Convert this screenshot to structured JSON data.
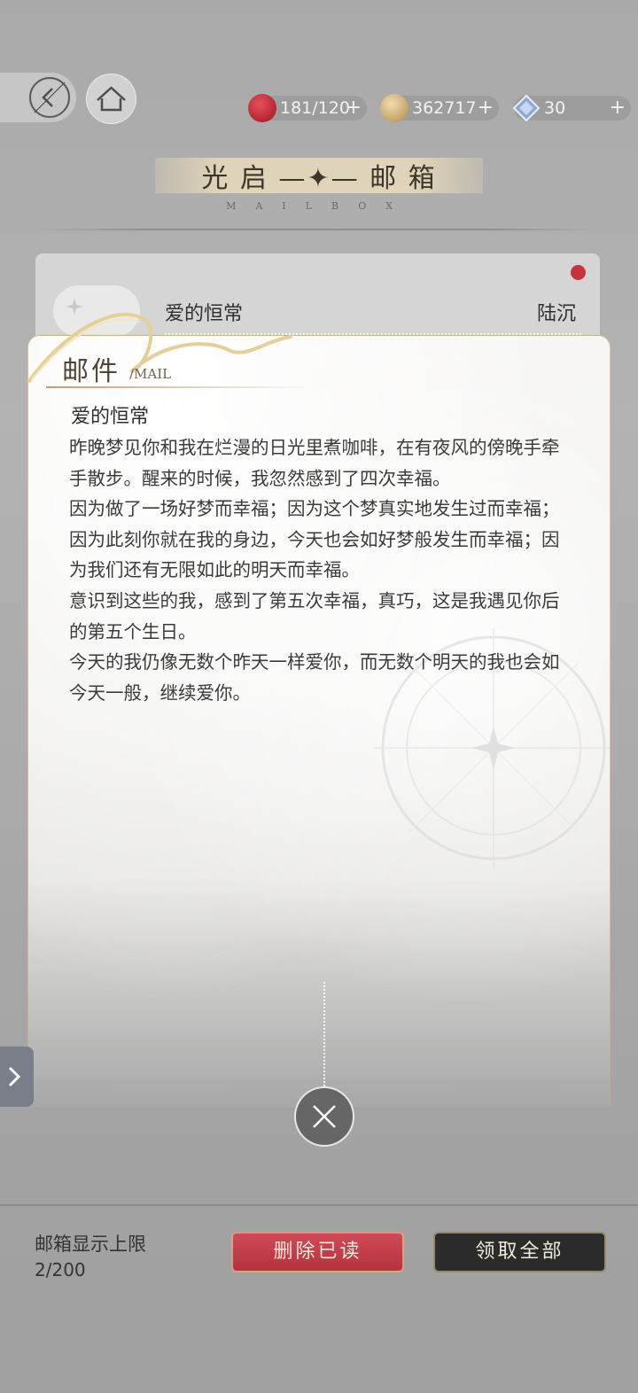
{
  "header": {
    "title": "光 启 —✦— 邮 箱",
    "subtitle": "MAILBOX"
  },
  "resources": [
    {
      "icon": "apple-icon",
      "value": "181/120",
      "plus": "+"
    },
    {
      "icon": "coin-icon",
      "value": "362717",
      "plus": "+"
    },
    {
      "icon": "diamond-icon",
      "value": "30",
      "plus": "+"
    }
  ],
  "mail_list": {
    "items": [
      {
        "title": "爱的恒常",
        "sender": "陆沉",
        "unread": true
      }
    ]
  },
  "mail_detail": {
    "label": "邮件",
    "label_en": "/MAIL",
    "title": "爱的恒常",
    "paragraphs": [
      "昨晚梦见你和我在烂漫的日光里煮咖啡，在有夜风的傍晚手牵手散步。醒来的时候，我忽然感到了四次幸福。",
      "因为做了一场好梦而幸福；因为这个梦真实地发生过而幸福；因为此刻你就在我的身边，今天也会如好梦般发生而幸福；因为我们还有无限如此的明天而幸福。",
      "意识到这些的我，感到了第五次幸福，真巧，这是我遇见你后的第五个生日。",
      "今天的我仍像无数个昨天一样爱你，而无数个明天的我也会如今天一般，继续爱你。"
    ]
  },
  "footer": {
    "limit_label": "邮箱显示上限",
    "limit_count": "2/200",
    "delete_read_label": "删除已读",
    "claim_all_label": "领取全部"
  },
  "colors": {
    "accent_red": "#c8333f",
    "gold": "#c8af78",
    "dark_button": "#2b2b2b"
  }
}
